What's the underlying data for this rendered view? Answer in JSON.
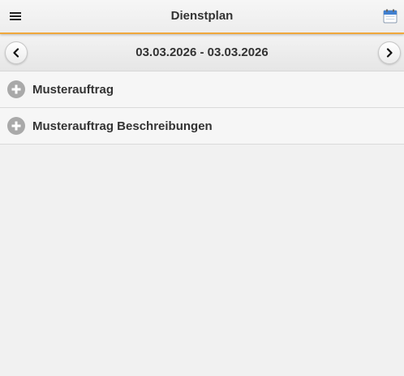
{
  "header": {
    "title": "Dienstplan",
    "menu_icon": "hamburger-menu-icon",
    "calendar_icon": "calendar-icon",
    "accent_color": "#f0a83c"
  },
  "datebar": {
    "range": "03.03.2026 - 03.03.2026",
    "prev_icon": "chevron-left-icon",
    "next_icon": "chevron-right-icon"
  },
  "list": {
    "items": [
      {
        "label": "Musterauftrag",
        "icon": "plus-circle-icon"
      },
      {
        "label": "Musterauftrag Beschreibungen",
        "icon": "plus-circle-icon"
      }
    ]
  }
}
